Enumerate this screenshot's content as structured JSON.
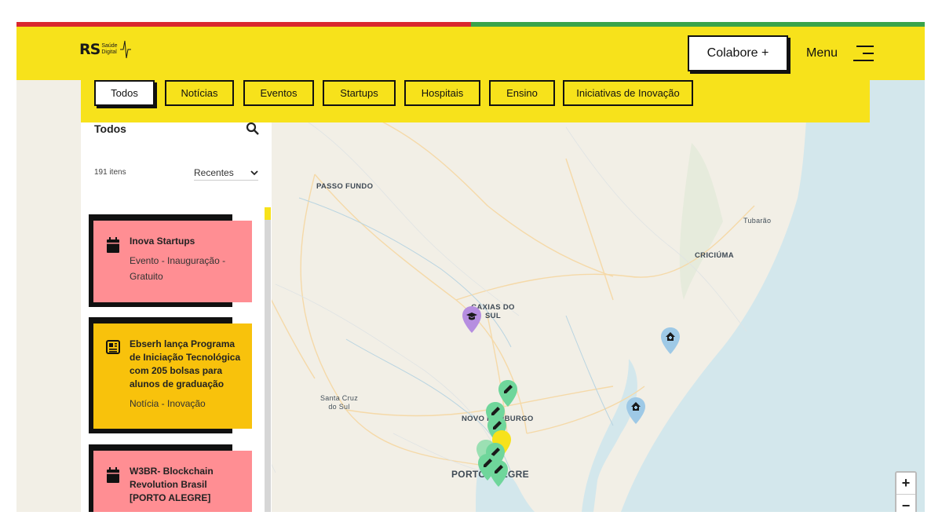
{
  "brand": {
    "logo_main": "RS",
    "logo_line1": "Saúde",
    "logo_line2": "Digital"
  },
  "header": {
    "colabore_label": "Colabore +",
    "menu_label": "Menu"
  },
  "filters": [
    {
      "label": "Todos",
      "active": true
    },
    {
      "label": "Notícias",
      "active": false
    },
    {
      "label": "Eventos",
      "active": false
    },
    {
      "label": "Startups",
      "active": false
    },
    {
      "label": "Hospitais",
      "active": false
    },
    {
      "label": "Ensino",
      "active": false
    },
    {
      "label": "Iniciativas de Inovação",
      "active": false
    }
  ],
  "sidebar": {
    "title": "Todos",
    "count": "191 itens",
    "sort_value": "Recentes",
    "items": [
      {
        "title": "Inova Startups",
        "meta": "Evento - Inauguração - Gratuito",
        "icon": "calendar-icon",
        "color": "#ff8e93"
      },
      {
        "title": "Ebserh lança Programa de Iniciação Tecnológica com 205 bolsas para alunos de graduação",
        "meta": "Notícia - Inovação",
        "icon": "newspaper-icon",
        "color": "#f8c20c"
      },
      {
        "title": "W3BR- Blockchain Revolution Brasil [PORTO ALEGRE]",
        "meta": "",
        "icon": "calendar-icon",
        "color": "#ff8e93"
      }
    ]
  },
  "map": {
    "labels": {
      "passo_fundo": "PASSO FUNDO",
      "caxias": "CAXIAS DO SUL",
      "santa_cruz": "Santa Cruz do Sul",
      "novo_hamburgo": "NOVO HAMBURGO",
      "porto_alegre": "PORTO ALEGRE",
      "tubarao": "Tubarão",
      "criciuma": "CRICIÚMA"
    },
    "zoom_in": "+",
    "zoom_out": "−",
    "colors": {
      "ocean": "#d3e7ec",
      "land": "#f2efe6",
      "pin_startup": "#6fd69b",
      "pin_hospital": "#9ec9e6",
      "pin_ensino": "#b68ee0",
      "accent": "#f7e21b"
    }
  }
}
